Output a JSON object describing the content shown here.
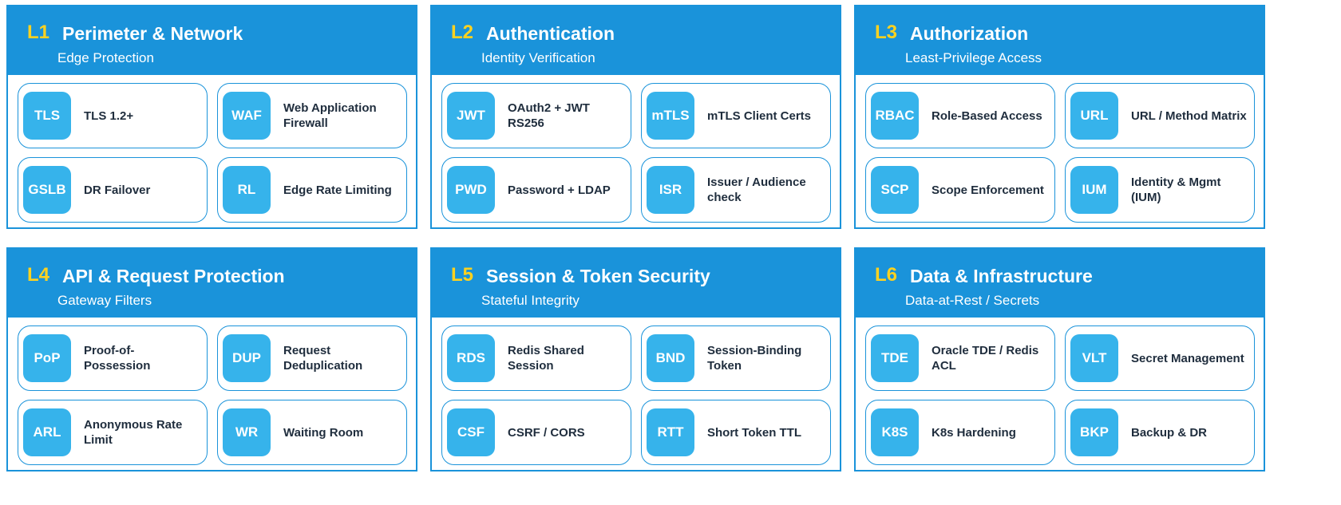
{
  "colors": {
    "layer_blue": "#1a93da",
    "badge_blue": "#36b3eb",
    "layer_id_yellow": "#ffd21f",
    "label_dark": "#1f2d3d"
  },
  "layers": [
    {
      "id": "L1",
      "title": "Perimeter & Network",
      "subtitle": "Edge Protection",
      "items": [
        {
          "badge": "TLS",
          "label": "TLS 1.2+"
        },
        {
          "badge": "WAF",
          "label": "Web Application Firewall"
        },
        {
          "badge": "GSLB",
          "label": "DR Failover"
        },
        {
          "badge": "RL",
          "label": "Edge Rate Limiting"
        }
      ]
    },
    {
      "id": "L2",
      "title": "Authentication",
      "subtitle": "Identity Verification",
      "items": [
        {
          "badge": "JWT",
          "label": "OAuth2 + JWT RS256"
        },
        {
          "badge": "mTLS",
          "label": "mTLS Client Certs"
        },
        {
          "badge": "PWD",
          "label": "Password + LDAP"
        },
        {
          "badge": "ISR",
          "label": "Issuer / Audience check"
        }
      ]
    },
    {
      "id": "L3",
      "title": "Authorization",
      "subtitle": "Least-Privilege Access",
      "items": [
        {
          "badge": "RBAC",
          "label": "Role-Based Access"
        },
        {
          "badge": "URL",
          "label": "URL / Method Matrix"
        },
        {
          "badge": "SCP",
          "label": "Scope Enforcement"
        },
        {
          "badge": "IUM",
          "label": "Identity & Mgmt (IUM)"
        }
      ]
    },
    {
      "id": "L4",
      "title": "API & Request Protection",
      "subtitle": "Gateway Filters",
      "items": [
        {
          "badge": "PoP",
          "label": "Proof-of-Possession"
        },
        {
          "badge": "DUP",
          "label": "Request Deduplication"
        },
        {
          "badge": "ARL",
          "label": "Anonymous Rate Limit"
        },
        {
          "badge": "WR",
          "label": "Waiting Room"
        }
      ]
    },
    {
      "id": "L5",
      "title": "Session & Token Security",
      "subtitle": "Stateful Integrity",
      "items": [
        {
          "badge": "RDS",
          "label": "Redis Shared Session"
        },
        {
          "badge": "BND",
          "label": "Session-Binding Token"
        },
        {
          "badge": "CSF",
          "label": "CSRF / CORS"
        },
        {
          "badge": "RTT",
          "label": "Short Token TTL"
        }
      ]
    },
    {
      "id": "L6",
      "title": "Data & Infrastructure",
      "subtitle": "Data-at-Rest / Secrets",
      "items": [
        {
          "badge": "TDE",
          "label": "Oracle TDE / Redis ACL"
        },
        {
          "badge": "VLT",
          "label": "Secret Management"
        },
        {
          "badge": "K8S",
          "label": "K8s Hardening"
        },
        {
          "badge": "BKP",
          "label": "Backup & DR"
        }
      ]
    }
  ]
}
